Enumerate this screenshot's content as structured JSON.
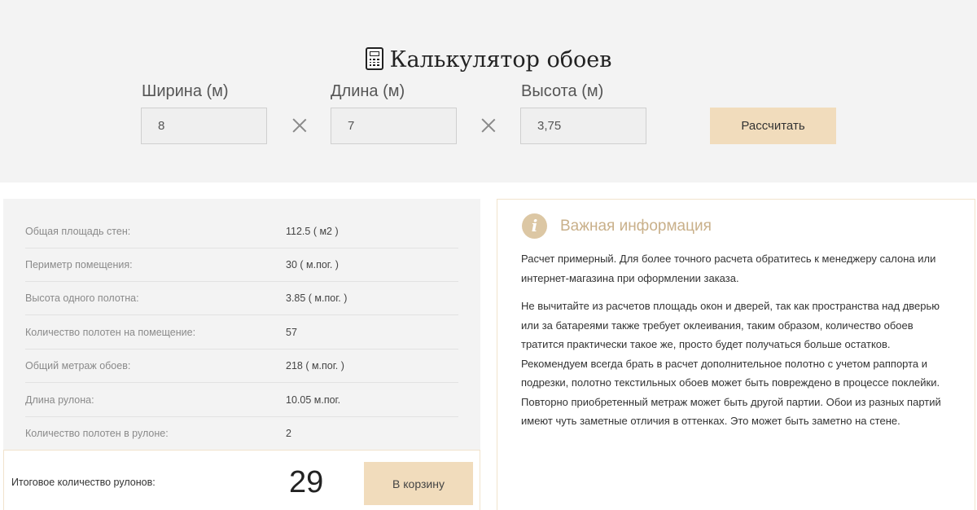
{
  "calculator": {
    "title": "Калькулятор обоев",
    "icon": "calculator-icon",
    "width": {
      "label": "Ширина (м)",
      "value": "8"
    },
    "length": {
      "label": "Длина (м)",
      "value": "7"
    },
    "height": {
      "label": "Высота (м)",
      "value": "3,75"
    },
    "calculate_label": "Рассчитать"
  },
  "results": {
    "rows": [
      {
        "label": "Общая площадь стен:",
        "value": "112.5 ( м2 )"
      },
      {
        "label": "Периметр помещения:",
        "value": "30 ( м.пог. )"
      },
      {
        "label": "Высота одного полотна:",
        "value": "3.85 ( м.пог. )"
      },
      {
        "label": "Количество полотен на помещение:",
        "value": "57"
      },
      {
        "label": "Общий метраж обоев:",
        "value": "218 ( м.пог. )"
      },
      {
        "label": "Длина рулона:",
        "value": "10.05 м.пог."
      },
      {
        "label": "Количество полотен в рулоне:",
        "value": "2"
      }
    ],
    "total_label": "Итоговое количество рулонов:",
    "total_value": "29",
    "cart_label": "В корзину"
  },
  "info": {
    "icon": "info-icon",
    "icon_glyph": "i",
    "title": "Важная информация",
    "paragraph1": "Расчет примерный. Для более точного расчета обратитесь к менеджеру салона или интернет-магазина при оформлении заказа.",
    "paragraph2": "Не вычитайте из расчетов площадь окон и дверей, так как пространства над дверью или за батареями также требует оклеивания, таким образом, количество обоев тратится практически такое же, просто будет получаться больше остатков. Рекомендуем всегда брать в расчет дополнительное полотно с учетом раппорта и подрезки, полотно текстильных обоев может быть повреждено в процессе поклейки. Повторно приобретенный метраж может быть другой партии. Обои из разных партий имеют чуть заметные отличия в оттенках. Это может быть заметно на стене."
  },
  "colors": {
    "background_band": "#f3f3f3",
    "accent_button": "#f1dcbc",
    "info_title": "#c9b08a",
    "info_icon": "#dcc7a4"
  }
}
